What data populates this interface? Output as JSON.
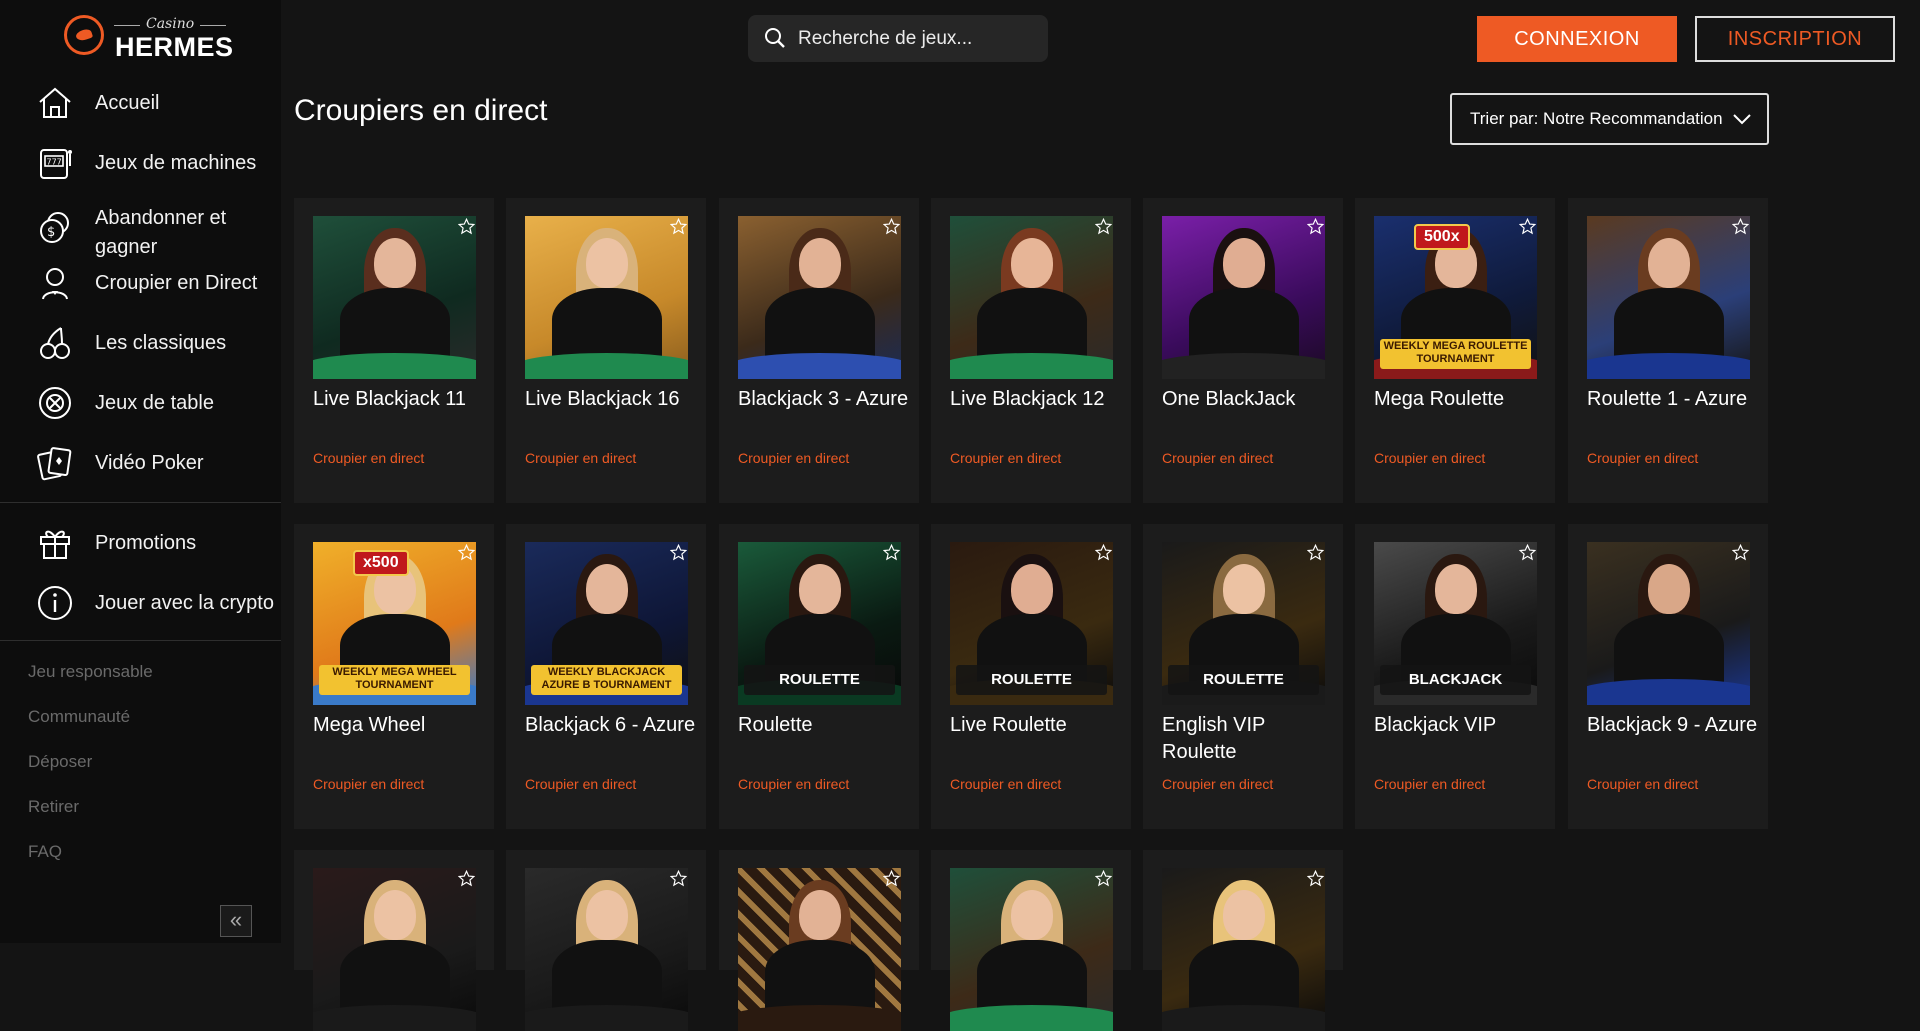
{
  "brand": {
    "casino": "Casino",
    "name": "HERMES"
  },
  "search": {
    "placeholder": "Recherche de jeux..."
  },
  "header": {
    "login": "CONNEXION",
    "signup": "INSCRIPTION"
  },
  "page": {
    "title": "Croupiers en direct",
    "sort_label": "Trier par: Notre Recommandation"
  },
  "sidebar": {
    "main_items": [
      {
        "label": "Accueil",
        "icon": "home-icon"
      },
      {
        "label": "Jeux de machines",
        "icon": "slot-machine-icon"
      },
      {
        "label": "Abandonner et gagner",
        "icon": "coins-icon"
      },
      {
        "label": "Croupier en Direct",
        "icon": "dealer-icon"
      },
      {
        "label": "Les classiques",
        "icon": "cherries-icon"
      },
      {
        "label": "Jeux de table",
        "icon": "chip-icon"
      },
      {
        "label": "Vidéo Poker",
        "icon": "cards-icon"
      }
    ],
    "secondary_items": [
      {
        "label": "Promotions",
        "icon": "gift-icon"
      },
      {
        "label": "Jouer avec la crypto",
        "icon": "info-icon"
      }
    ],
    "footer_links": [
      "Jeu responsable",
      "Communauté",
      "Déposer",
      "Retirer",
      "FAQ"
    ],
    "collapse_label": "«"
  },
  "games": [
    {
      "name": "Live Blackjack 11",
      "category": "Croupier en direct"
    },
    {
      "name": "Live Blackjack 16",
      "category": "Croupier en direct"
    },
    {
      "name": "Blackjack 3 - Azure",
      "category": "Croupier en direct"
    },
    {
      "name": "Live Blackjack 12",
      "category": "Croupier en direct"
    },
    {
      "name": "One BlackJack",
      "category": "Croupier en direct"
    },
    {
      "name": "Mega Roulette",
      "category": "Croupier en direct",
      "banner": "WEEKLY MEGA ROULETTE TOURNAMENT",
      "badge": "500x"
    },
    {
      "name": "Roulette 1 - Azure",
      "category": "Croupier en direct"
    },
    {
      "name": "Mega Wheel",
      "category": "Croupier en direct",
      "banner": "WEEKLY MEGA WHEEL TOURNAMENT",
      "badge": "x500"
    },
    {
      "name": "Blackjack 6 - Azure",
      "category": "Croupier en direct",
      "banner": "WEEKLY BLACKJACK AZURE B TOURNAMENT"
    },
    {
      "name": "Roulette",
      "category": "Croupier en direct",
      "banner": "ROULETTE"
    },
    {
      "name": "Live Roulette",
      "category": "Croupier en direct",
      "banner": "ROULETTE"
    },
    {
      "name": "English VIP Roulette",
      "category": "Croupier en direct",
      "banner": "ROULETTE"
    },
    {
      "name": "Blackjack VIP",
      "category": "Croupier en direct",
      "banner": "BLACKJACK"
    },
    {
      "name": "Blackjack 9 - Azure",
      "category": "Croupier en direct"
    },
    {
      "name": "",
      "category": ""
    },
    {
      "name": "",
      "category": ""
    },
    {
      "name": "",
      "category": ""
    },
    {
      "name": "",
      "category": ""
    },
    {
      "name": "",
      "category": ""
    }
  ],
  "colors": {
    "accent": "#ee5a24",
    "background": "#141414",
    "sidebar": "#0d0d0d",
    "card": "#1c1c1c"
  }
}
